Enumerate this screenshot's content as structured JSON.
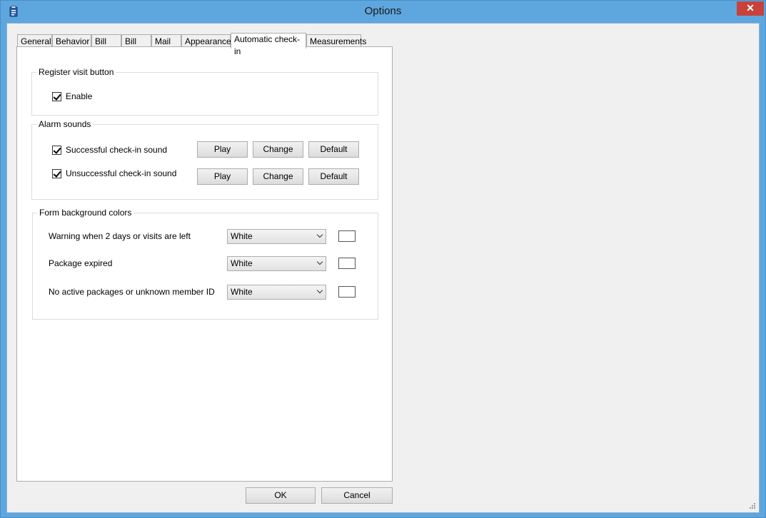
{
  "window": {
    "title": "Options",
    "close_glyph": "✕"
  },
  "tabs": [
    {
      "label": "General",
      "active": false
    },
    {
      "label": "Behavior",
      "active": false
    },
    {
      "label": "Bill",
      "active": false
    },
    {
      "label": "Bill",
      "active": false
    },
    {
      "label": "Mail",
      "active": false
    },
    {
      "label": "Appearance",
      "active": false
    },
    {
      "label": "Automatic check-in",
      "active": true
    },
    {
      "label": "Measurements",
      "active": false
    }
  ],
  "register_visit": {
    "title": "Register visit button",
    "enable_label": "Enable",
    "enable_checked": true
  },
  "alarm_sounds": {
    "title": "Alarm sounds",
    "rows": [
      {
        "label": "Successful check-in sound",
        "checked": true,
        "play": "Play",
        "change": "Change",
        "default": "Default"
      },
      {
        "label": "Unsuccessful check-in sound",
        "checked": true,
        "play": "Play",
        "change": "Change",
        "default": "Default"
      }
    ]
  },
  "form_colors": {
    "title": "Form background colors",
    "rows": [
      {
        "label": "Warning when 2 days or visits are left",
        "value": "White",
        "swatch_color": "#ffffff"
      },
      {
        "label": "Package expired",
        "value": "White",
        "swatch_color": "#ffffff"
      },
      {
        "label": "No active packages or unknown member ID",
        "value": "White",
        "swatch_color": "#ffffff"
      }
    ]
  },
  "footer": {
    "ok_label": "OK",
    "cancel_label": "Cancel"
  }
}
